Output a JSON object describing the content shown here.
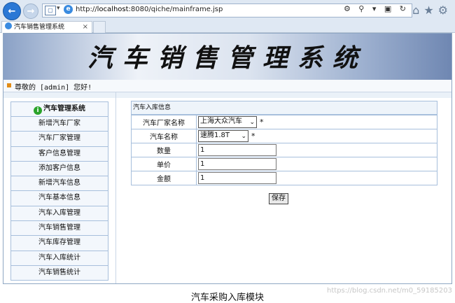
{
  "browser": {
    "url_prefix": "http://",
    "url_host": "localhost",
    "url_rest": ":8080/qiche/mainframe.jsp",
    "tab_title": "汽车销售管理系统",
    "tab_close": "×"
  },
  "app": {
    "banner_title": "汽车销售管理系统",
    "welcome_text": "尊敬的 [admin] 您好!"
  },
  "sidebar": {
    "heading": "汽车管理系统",
    "items": [
      {
        "label": "新增汽车厂家"
      },
      {
        "label": "汽车厂家管理"
      },
      {
        "label": "客户信息管理"
      },
      {
        "label": "添加客户信息"
      },
      {
        "label": "新增汽车信息"
      },
      {
        "label": "汽车基本信息"
      },
      {
        "label": "汽车入库管理"
      },
      {
        "label": "汽车销售管理"
      },
      {
        "label": "汽车库存管理"
      },
      {
        "label": "汽车入库统计"
      },
      {
        "label": "汽车销售统计"
      }
    ]
  },
  "form": {
    "title": "汽车入库信息",
    "manufacturer_label": "汽车厂家名称",
    "manufacturer_value": "上海大众汽车",
    "car_label": "汽车名称",
    "car_value": "速腾1.8T",
    "required_mark": "*",
    "quantity_label": "数量",
    "quantity_value": "1",
    "price_label": "单价",
    "price_value": "1",
    "amount_label": "金额",
    "amount_value": "1",
    "save_label": "保存"
  },
  "caption": "汽车采购入库模块",
  "watermark": "https://blog.csdn.net/m0_59185203"
}
